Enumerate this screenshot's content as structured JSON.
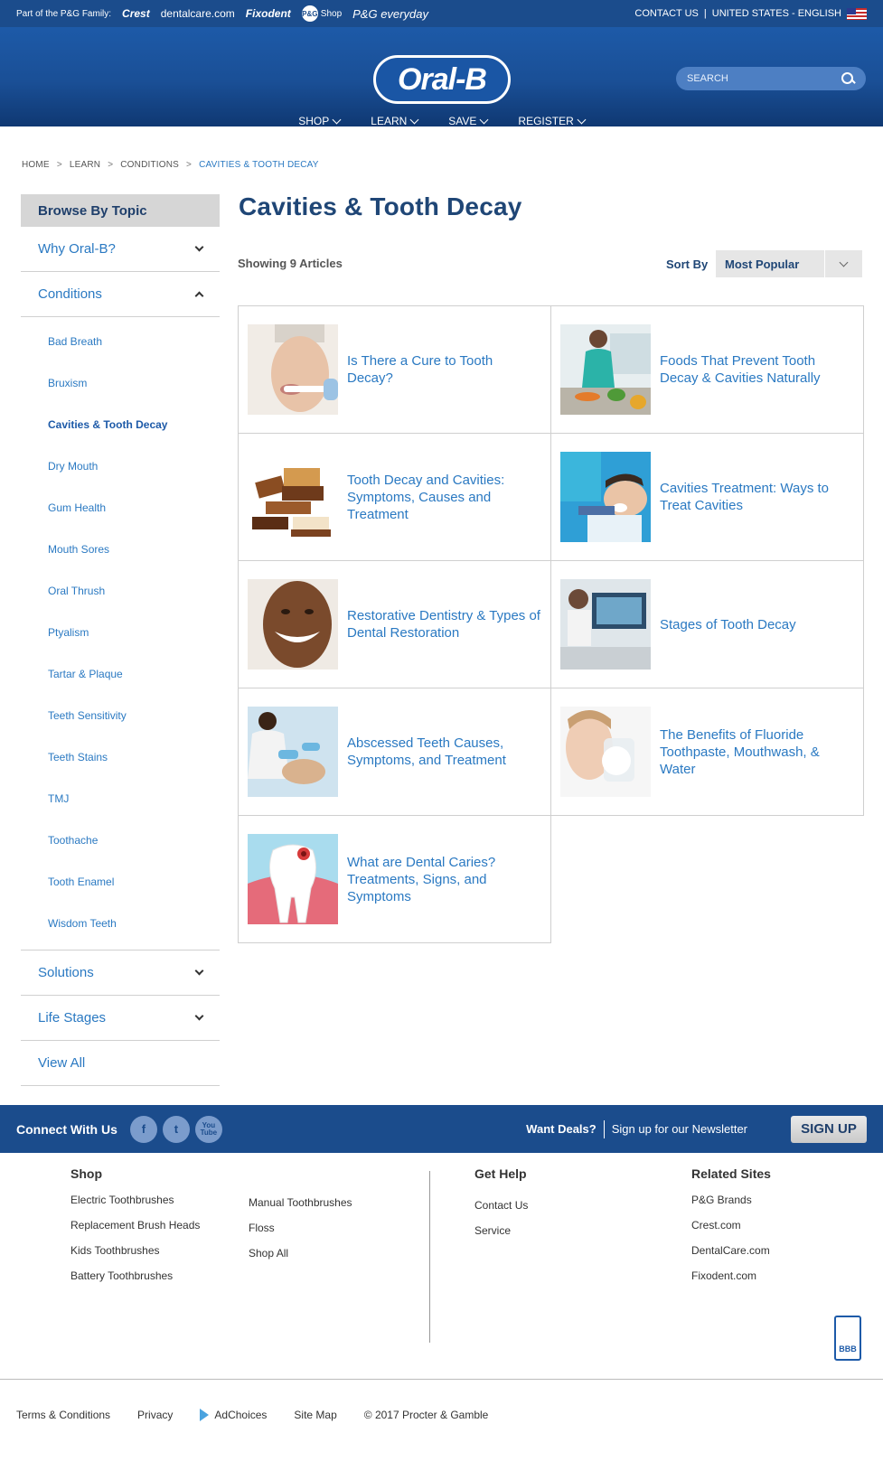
{
  "topbar": {
    "family_label": "Part of the P&G Family:",
    "brands": [
      "Crest",
      "dentalcare.com",
      "Fixodent",
      "Shop",
      "P&G everyday"
    ],
    "pg_circle": "P&G",
    "contact": "CONTACT US",
    "divider": "|",
    "region": "UNITED STATES - ENGLISH"
  },
  "header": {
    "logo": "Oral-B",
    "search_placeholder": "SEARCH",
    "nav": [
      "SHOP",
      "LEARN",
      "SAVE",
      "REGISTER"
    ]
  },
  "breadcrumb": [
    "HOME",
    "LEARN",
    "CONDITIONS",
    "CAVITIES & TOOTH DECAY"
  ],
  "breadcrumb_sep": ">",
  "sidebar": {
    "heading": "Browse By Topic",
    "sections": [
      {
        "label": "Why Oral-B?"
      },
      {
        "label": "Conditions"
      },
      {
        "label": "Solutions"
      },
      {
        "label": "Life Stages"
      },
      {
        "label": "View All"
      }
    ],
    "conditions": [
      "Bad Breath",
      "Bruxism",
      "Cavities & Tooth Decay",
      "Dry Mouth",
      "Gum Health",
      "Mouth Sores",
      "Oral Thrush",
      "Ptyalism",
      "Tartar & Plaque",
      "Teeth Sensitivity",
      "Teeth Stains",
      "TMJ",
      "Toothache",
      "Tooth Enamel",
      "Wisdom Teeth"
    ]
  },
  "main": {
    "title": "Cavities & Tooth Decay",
    "showing": "Showing 9 Articles",
    "sort_label": "Sort By",
    "sort_value": "Most Popular",
    "articles": [
      "Is There a Cure to Tooth Decay?",
      "Foods That Prevent Tooth Decay & Cavities Naturally",
      "Tooth Decay and Cavities: Symptoms, Causes and Treatment",
      "Cavities Treatment: Ways to Treat Cavities",
      "Restorative Dentistry & Types of Dental Restoration",
      "Stages of Tooth Decay",
      "Abscessed Teeth Causes, Symptoms, and Treatment",
      "The Benefits of Fluoride Toothpaste, Mouthwash, & Water",
      "What are Dental Caries? Treatments, Signs, and Symptoms"
    ]
  },
  "connect": {
    "label": "Connect With Us",
    "social": [
      "f",
      "t",
      "You Tube"
    ],
    "deals": "Want Deals?",
    "newsletter": "Sign up for our Newsletter",
    "signup": "SIGN UP"
  },
  "footer": {
    "shop": {
      "heading": "Shop",
      "col1": [
        "Electric Toothbrushes",
        "Replacement Brush Heads",
        "Kids Toothbrushes",
        "Battery Toothbrushes"
      ],
      "col2": [
        "Manual Toothbrushes",
        "Floss",
        "Shop All"
      ]
    },
    "help": {
      "heading": "Get Help",
      "links": [
        "Contact Us",
        "Service"
      ]
    },
    "related": {
      "heading": "Related Sites",
      "links": [
        "P&G Brands",
        "Crest.com",
        "DentalCare.com",
        "Fixodent.com"
      ]
    },
    "bbb": "BBB",
    "bottom": [
      "Terms & Conditions",
      "Privacy",
      "AdChoices",
      "Site Map",
      "© 2017 Procter & Gamble"
    ]
  },
  "colors": {
    "brand_blue": "#1b4c8c",
    "link_blue": "#2a79c2",
    "title_navy": "#1f4676"
  }
}
